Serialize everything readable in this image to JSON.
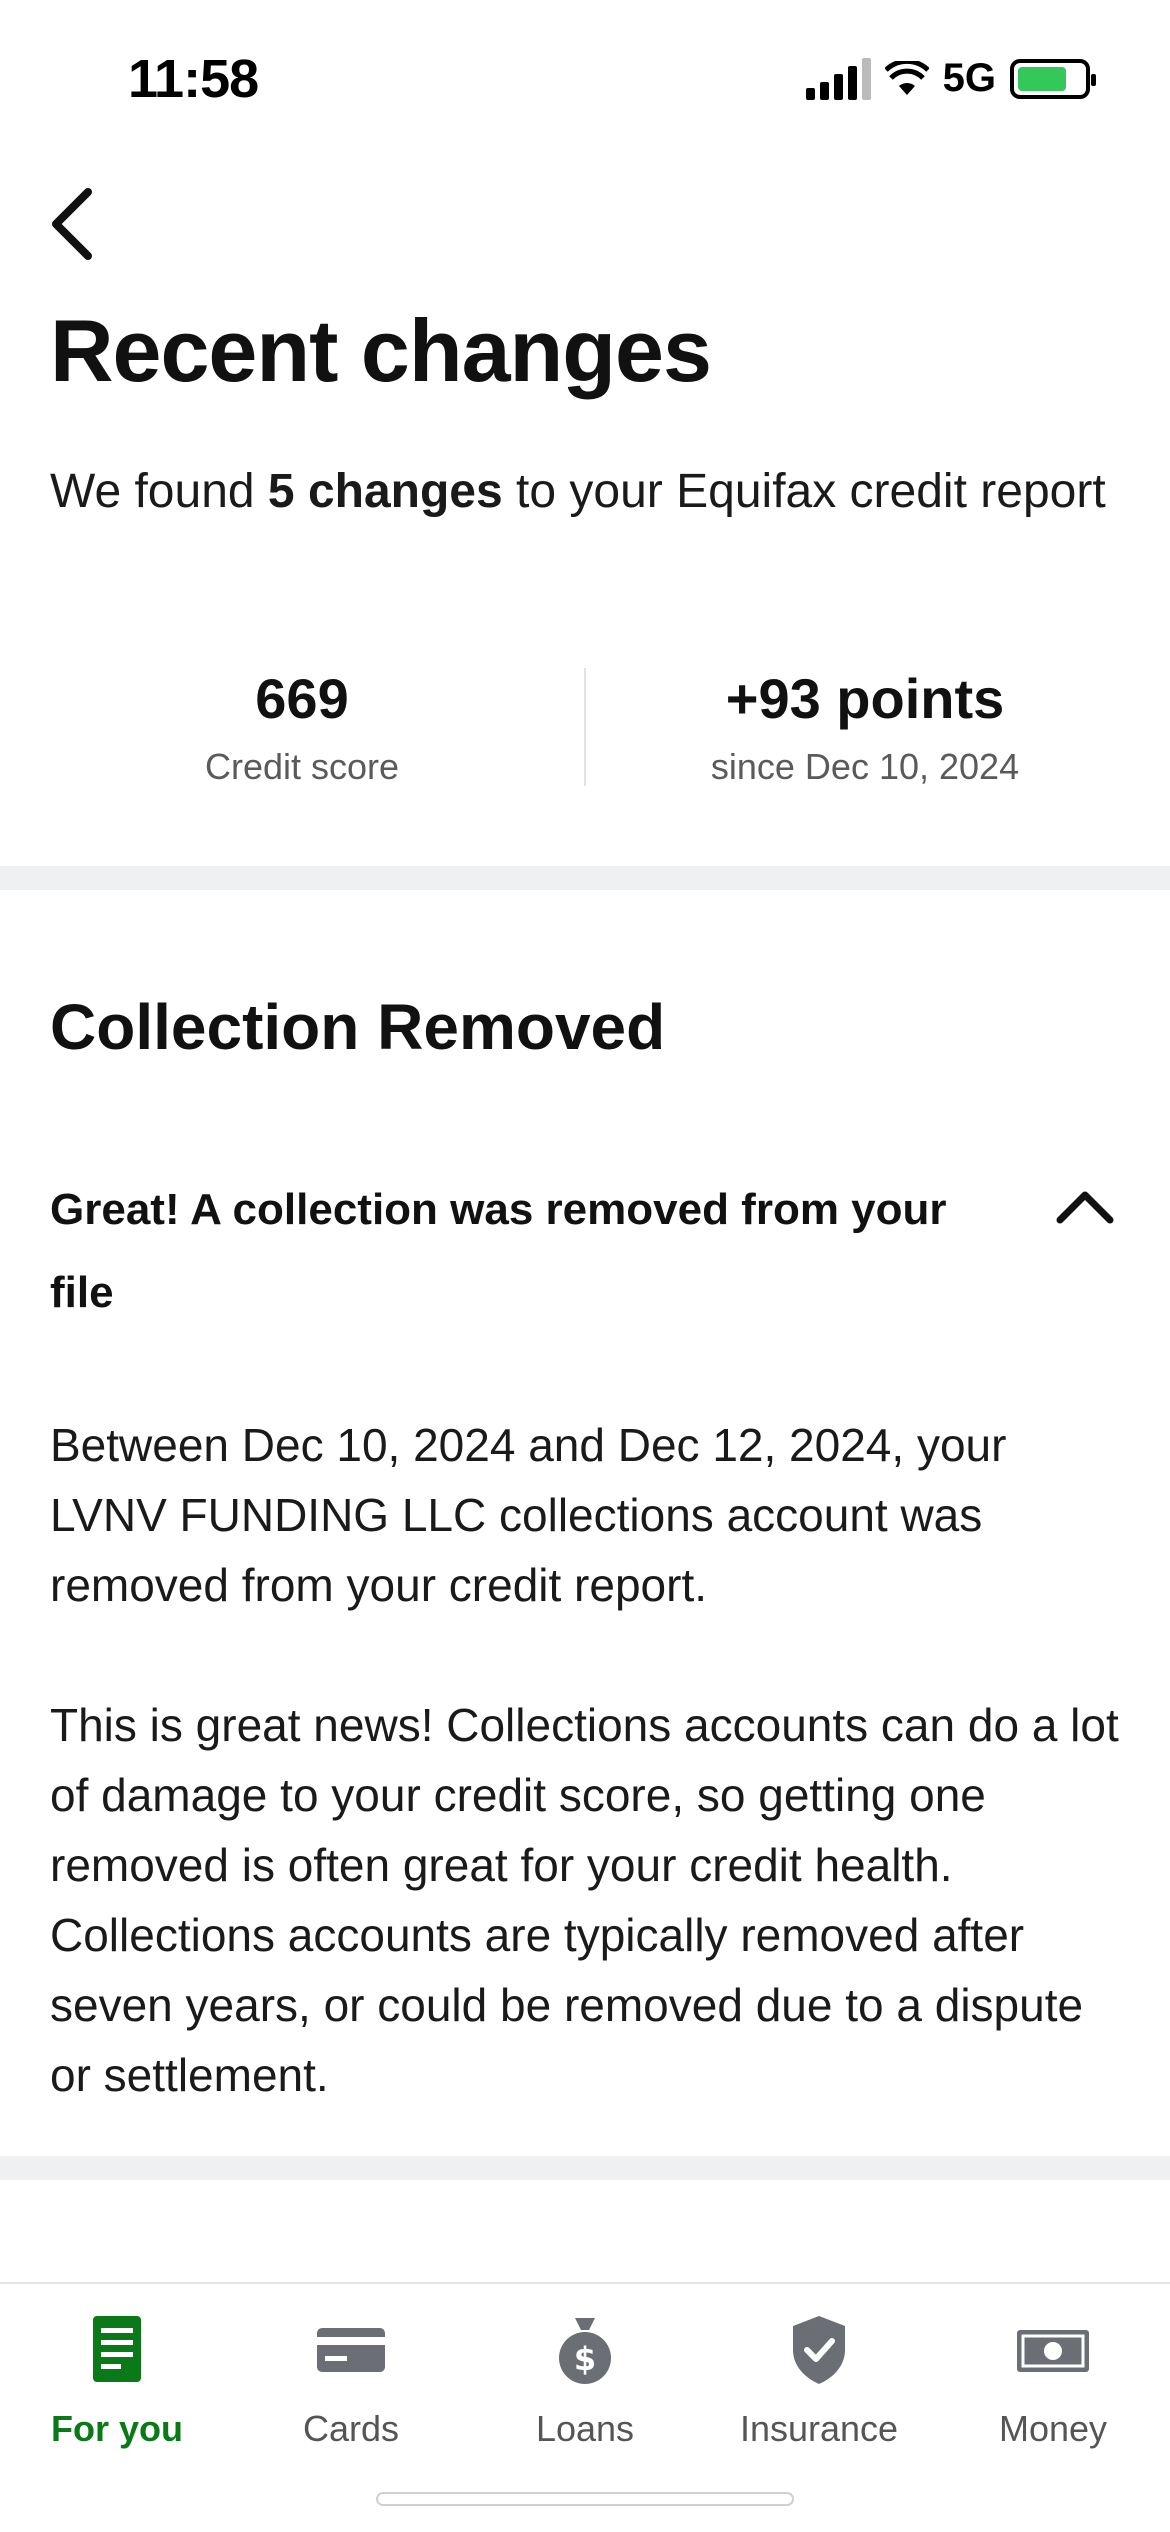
{
  "status_bar": {
    "time": "11:58",
    "network": "5G"
  },
  "header": {
    "title": "Recent changes"
  },
  "intro": {
    "prefix": "We found ",
    "highlight": "5 changes",
    "suffix": " to your Equifax credit report"
  },
  "stats": {
    "score_value": "669",
    "score_label": "Credit score",
    "change_value": "+93 points",
    "change_label": "since Dec 10, 2024"
  },
  "section": {
    "title": "Collection Removed",
    "accordion_title": "Great! A collection was removed from your file",
    "paragraph_1": "Between Dec 10, 2024 and Dec 12, 2024, your LVNV FUNDING LLC collections account was removed from your credit report.",
    "paragraph_2": "This is great news! Collections accounts can do a lot of damage to your credit score, so getting one removed is often great for your credit health. Collections accounts are typically removed after seven years, or could be removed due to a dispute or settlement."
  },
  "tabbar": {
    "tabs": [
      {
        "label": "For you",
        "icon": "document-icon",
        "active": true
      },
      {
        "label": "Cards",
        "icon": "credit-card-icon",
        "active": false
      },
      {
        "label": "Loans",
        "icon": "money-bag-icon",
        "active": false
      },
      {
        "label": "Insurance",
        "icon": "shield-icon",
        "active": false
      },
      {
        "label": "Money",
        "icon": "banknote-icon",
        "active": false
      }
    ]
  },
  "colors": {
    "accent_green": "#0a7a18",
    "battery_green": "#34c759",
    "band_gray": "#eef0f2",
    "icon_gray": "#6b6f75"
  }
}
